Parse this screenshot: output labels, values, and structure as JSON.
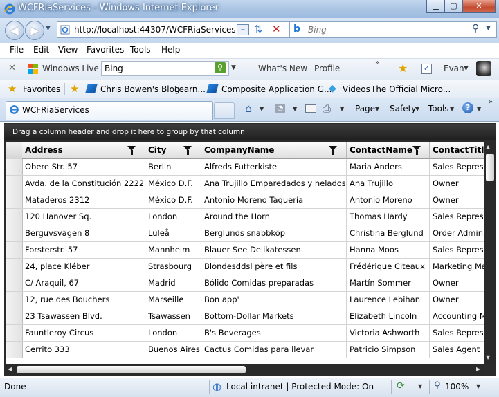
{
  "window": {
    "title": "WCFRiaServices - Windows Internet Explorer"
  },
  "address": {
    "url": "http://localhost:44307/WCFRiaServices`"
  },
  "search": {
    "placeholder": "Bing"
  },
  "menu": [
    "File",
    "Edit",
    "View",
    "Favorites",
    "Tools",
    "Help"
  ],
  "livebar": {
    "brand": "Windows Live",
    "search_value": "Bing",
    "whats_new": "What's New",
    "profile": "Profile",
    "user": "Evan"
  },
  "favorites": {
    "label": "Favorites",
    "items": [
      "Chris Bowen's Blog",
      "Learn...",
      "Composite Application G...",
      "Videos",
      "The Official Micro..."
    ]
  },
  "tab": {
    "title": "WCFRiaServices"
  },
  "commandbar": {
    "page": "Page",
    "safety": "Safety",
    "tools": "Tools"
  },
  "grid": {
    "group_hint": "Drag a column header and drop it here to group by that column",
    "columns": [
      "Address",
      "City",
      "CompanyName",
      "ContactName",
      "ContactTitle"
    ],
    "rows": [
      [
        "Obere Str. 57",
        "Berlin",
        "Alfreds Futterkiste",
        "Maria Anders",
        "Sales Representative"
      ],
      [
        "Avda. de la Constitución 2222",
        "México D.F.",
        "Ana Trujillo Emparedados y helados",
        "Ana Trujillo",
        "Owner"
      ],
      [
        "Mataderos  2312",
        "México D.F.",
        "Antonio Moreno Taquería",
        "Antonio Moreno",
        "Owner"
      ],
      [
        "120 Hanover Sq.",
        "London",
        "Around the Horn",
        "Thomas Hardy",
        "Sales Representative"
      ],
      [
        "Berguvsvägen  8",
        "Luleå",
        "Berglunds snabbköp",
        "Christina Berglund",
        "Order Administrator"
      ],
      [
        "Forsterstr. 57",
        "Mannheim",
        "Blauer See Delikatessen",
        "Hanna Moos",
        "Sales Representative"
      ],
      [
        "24, place Kléber",
        "Strasbourg",
        "Blondesddsl père et fils",
        "Frédérique Citeaux",
        "Marketing Manager"
      ],
      [
        "C/ Araquil, 67",
        "Madrid",
        "Bólido Comidas preparadas",
        "Martín Sommer",
        "Owner"
      ],
      [
        "12, rue des Bouchers",
        "Marseille",
        "Bon app'",
        "Laurence Lebihan",
        "Owner"
      ],
      [
        "23 Tsawassen Blvd.",
        "Tsawassen",
        "Bottom-Dollar Markets",
        "Elizabeth Lincoln",
        "Accounting Manager"
      ],
      [
        "Fauntleroy Circus",
        "London",
        "B's Beverages",
        "Victoria Ashworth",
        "Sales Representative"
      ],
      [
        "Cerrito 333",
        "Buenos Aires",
        "Cactus Comidas para llevar",
        "Patricio Simpson",
        "Sales Agent"
      ]
    ]
  },
  "status": {
    "left": "Done",
    "zone": "Local intranet | Protected Mode: On",
    "zoom": "100%"
  }
}
